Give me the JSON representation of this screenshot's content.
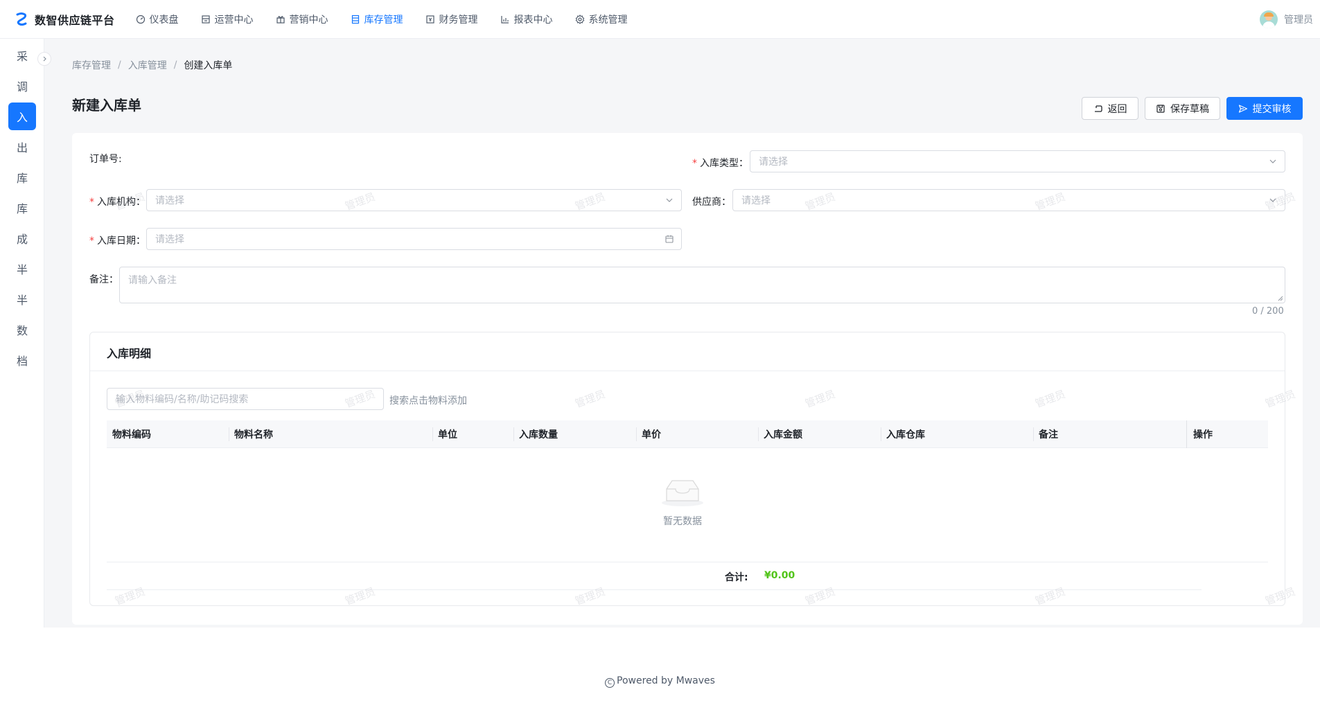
{
  "app": {
    "name": "数智供应链平台",
    "user": "管理员"
  },
  "nav": [
    {
      "label": "仪表盘",
      "icon": "dashboard-icon"
    },
    {
      "label": "运营中心",
      "icon": "store-icon"
    },
    {
      "label": "营销中心",
      "icon": "gift-icon"
    },
    {
      "label": "库存管理",
      "icon": "inventory-icon",
      "active": true
    },
    {
      "label": "财务管理",
      "icon": "finance-icon"
    },
    {
      "label": "报表中心",
      "icon": "chart-icon"
    },
    {
      "label": "系统管理",
      "icon": "gear-icon"
    }
  ],
  "sidebar": [
    "采",
    "调",
    "入",
    "出",
    "库",
    "库",
    "成",
    "半",
    "半",
    "数",
    "档"
  ],
  "breadcrumb": [
    "库存管理",
    "入库管理",
    "创建入库单"
  ],
  "page": {
    "title": "新建入库单",
    "back": "返回",
    "save_draft": "保存草稿",
    "submit": "提交审核"
  },
  "form": {
    "order_no_label": "订单号:",
    "type_label": "入库类型：",
    "type_placeholder": "请选择",
    "org_label": "入库机构：",
    "org_placeholder": "请选择",
    "supplier_label": "供应商：",
    "supplier_placeholder": "请选择",
    "date_label": "入库日期：",
    "date_placeholder": "请选择",
    "remark_label": "备注：",
    "remark_placeholder": "请输入备注",
    "remark_count": "0 / 200",
    "required_mark": "*"
  },
  "detail": {
    "title": "入库明细",
    "search_placeholder": "输入物料编码/名称/助记码搜索",
    "search_hint": "搜索点击物料添加",
    "columns": [
      "物料编码",
      "物料名称",
      "单位",
      "入库数量",
      "单价",
      "入库金额",
      "入库仓库",
      "备注",
      "操作"
    ],
    "empty": "暂无数据",
    "total_label": "合计:",
    "total_value": "¥0.00"
  },
  "watermark": "管理员",
  "footer": "Powered by Mwaves",
  "colors": {
    "primary": "#1677ff",
    "required": "#f53f3f",
    "total": "#52c41a"
  }
}
